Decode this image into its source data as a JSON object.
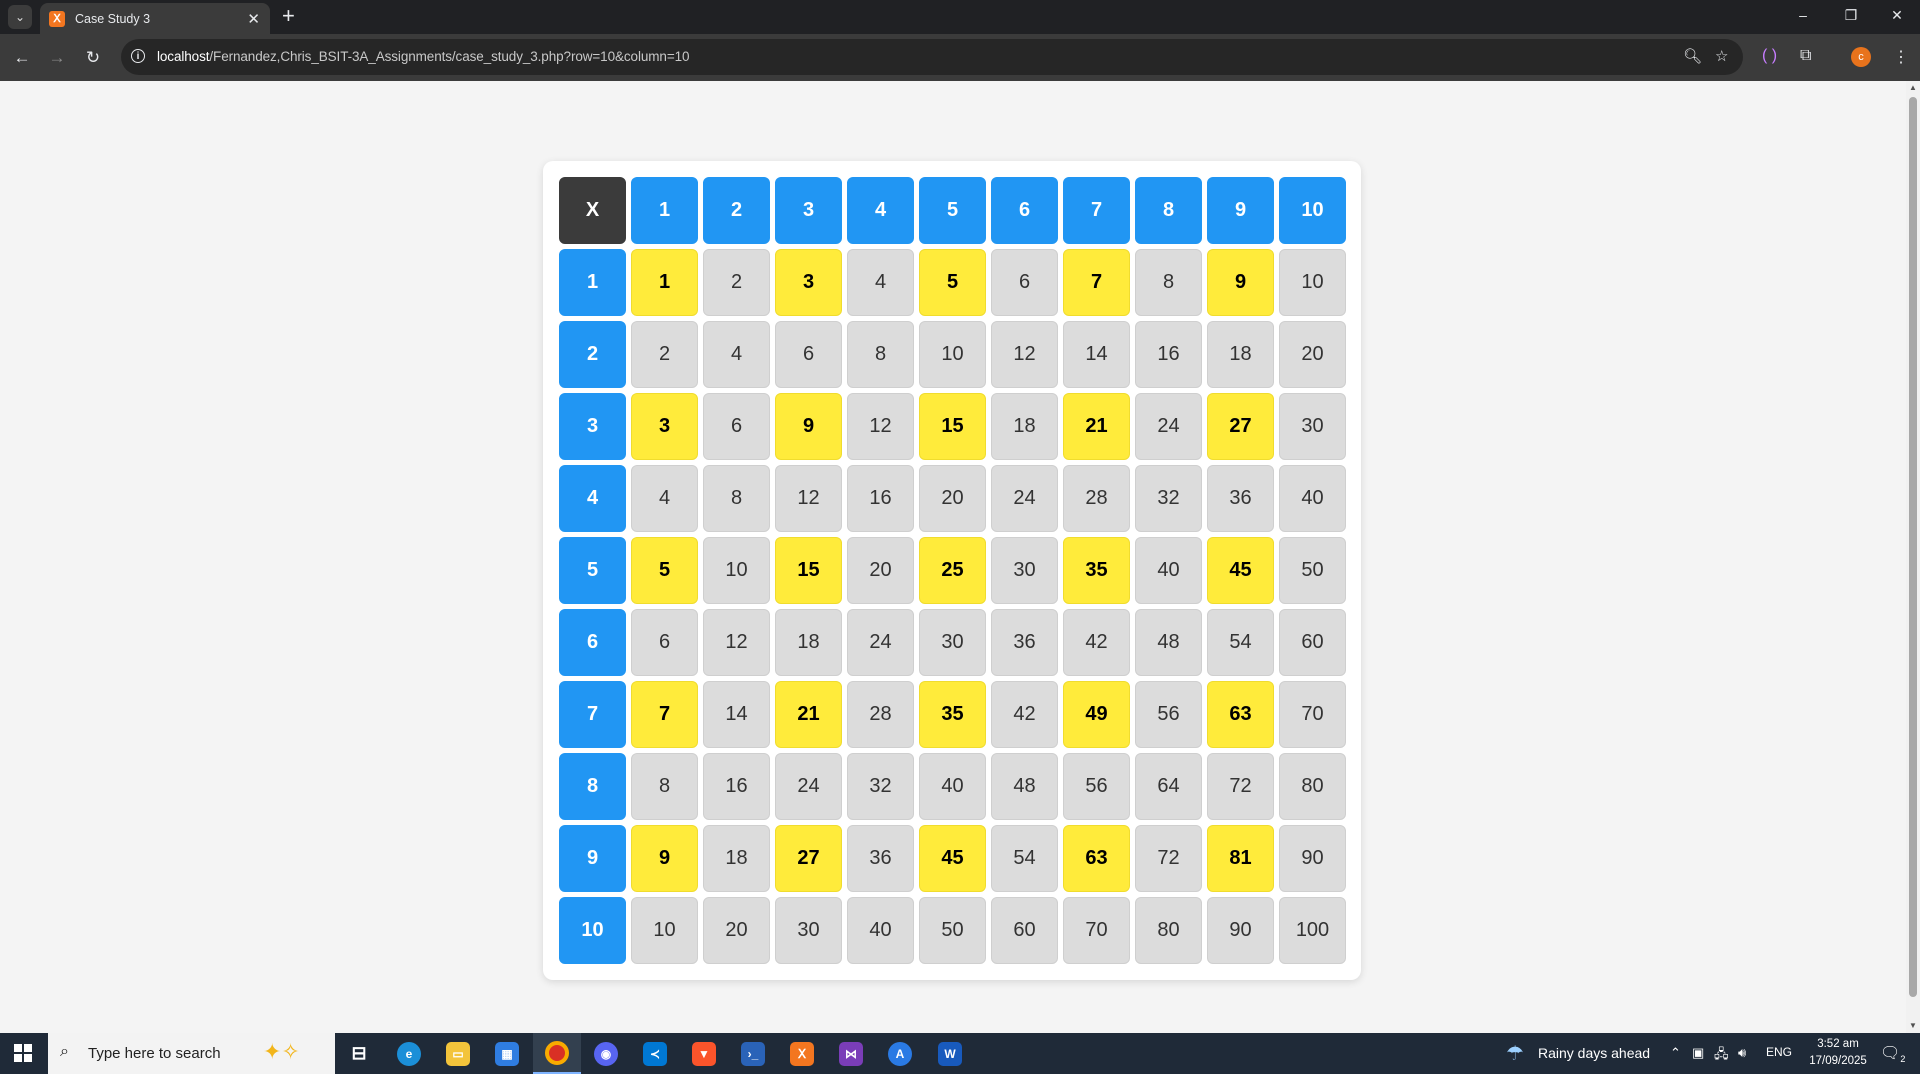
{
  "browser": {
    "tab_title": "Case Study 3",
    "url_host": "localhost",
    "url_path": "/Fernandez,Chris_BSIT-3A_Assignments/case_study_3.php?row=10&column=10"
  },
  "table": {
    "corner": "X",
    "column_headers": [
      "1",
      "2",
      "3",
      "4",
      "5",
      "6",
      "7",
      "8",
      "9",
      "10"
    ],
    "rows": [
      {
        "header": "1",
        "cells": [
          "1",
          "2",
          "3",
          "4",
          "5",
          "6",
          "7",
          "8",
          "9",
          "10"
        ]
      },
      {
        "header": "2",
        "cells": [
          "2",
          "4",
          "6",
          "8",
          "10",
          "12",
          "14",
          "16",
          "18",
          "20"
        ]
      },
      {
        "header": "3",
        "cells": [
          "3",
          "6",
          "9",
          "12",
          "15",
          "18",
          "21",
          "24",
          "27",
          "30"
        ]
      },
      {
        "header": "4",
        "cells": [
          "4",
          "8",
          "12",
          "16",
          "20",
          "24",
          "28",
          "32",
          "36",
          "40"
        ]
      },
      {
        "header": "5",
        "cells": [
          "5",
          "10",
          "15",
          "20",
          "25",
          "30",
          "35",
          "40",
          "45",
          "50"
        ]
      },
      {
        "header": "6",
        "cells": [
          "6",
          "12",
          "18",
          "24",
          "30",
          "36",
          "42",
          "48",
          "54",
          "60"
        ]
      },
      {
        "header": "7",
        "cells": [
          "7",
          "14",
          "21",
          "28",
          "35",
          "42",
          "49",
          "56",
          "63",
          "70"
        ]
      },
      {
        "header": "8",
        "cells": [
          "8",
          "16",
          "24",
          "32",
          "40",
          "48",
          "56",
          "64",
          "72",
          "80"
        ]
      },
      {
        "header": "9",
        "cells": [
          "9",
          "18",
          "27",
          "36",
          "45",
          "54",
          "63",
          "72",
          "81",
          "90"
        ]
      },
      {
        "header": "10",
        "cells": [
          "10",
          "20",
          "30",
          "40",
          "50",
          "60",
          "70",
          "80",
          "90",
          "100"
        ]
      }
    ],
    "colors": {
      "header": "#2196f3",
      "corner": "#3b3b3b",
      "odd": "#ffeb3b",
      "even": "#dcdcdc"
    }
  },
  "taskbar": {
    "search_placeholder": "Type here to search",
    "weather": "Rainy days ahead",
    "language": "ENG",
    "time": "3:52 am",
    "date": "17/09/2025",
    "notification_count": "2"
  }
}
